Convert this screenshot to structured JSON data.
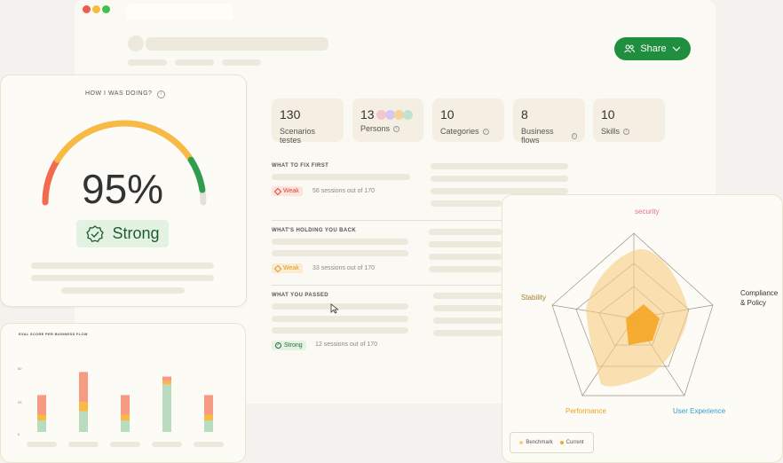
{
  "header": {
    "share_label": "Share",
    "share_color": "#1f8e3e"
  },
  "stats": [
    {
      "value": "130",
      "label": "Scenarios testes",
      "info": false
    },
    {
      "value": "13",
      "label": "Persons",
      "info": true
    },
    {
      "value": "10",
      "label": "Categories",
      "info": true
    },
    {
      "value": "8",
      "label": "Business flows",
      "info": true
    },
    {
      "value": "10",
      "label": "Skills",
      "info": true
    }
  ],
  "sections": {
    "fix": {
      "title": "WHAT TO FIX FIRST",
      "badge": "Weak",
      "sessions": "56 sessions out of 170"
    },
    "holding": {
      "title": "WHAT'S HOLDING YOU BACK",
      "badge": "Weak",
      "sessions": "33 sessions out of 170"
    },
    "passed": {
      "title": "WHAT YOU PASSED",
      "badge": "Strong",
      "sessions": "12 sessions out of 170"
    }
  },
  "score": {
    "title": "HOW I WAS DOING?",
    "value": "95%",
    "value_fraction": 0.95,
    "status": "Strong",
    "gauge_colors": [
      "#f36b4f",
      "#f9b945",
      "#2f9d4e",
      "#d6d3c7"
    ]
  },
  "eval_chart": {
    "title": "EVAL SCORE PER BUSINESS FLOW",
    "yticks": [
      "50",
      "25",
      "0"
    ]
  },
  "chart_data": {
    "type": "bar",
    "title": "EVAL SCORE PER BUSINESS FLOW",
    "categories": [
      "",
      "",
      "",
      "",
      ""
    ],
    "stacked": true,
    "ylim": [
      0,
      60
    ],
    "series": [
      {
        "color": "#b9dbbf",
        "values": [
          10,
          18,
          10,
          41,
          10
        ]
      },
      {
        "color": "#f9b945",
        "values": [
          5,
          8,
          5,
          3,
          5
        ]
      },
      {
        "color": "#f79a82",
        "values": [
          17,
          26,
          17,
          4,
          17
        ]
      }
    ]
  },
  "radar": {
    "axes": [
      "security",
      "Compliance & Policy",
      "User Experience",
      "Performance",
      "Stability"
    ],
    "axis_colors": [
      "#e96b9c",
      "#333333",
      "#2f9fd0",
      "#e8a41e",
      "#a37f33"
    ],
    "legend": [
      "Benchmark",
      "Current"
    ],
    "benchmark_color": "#f9cf82",
    "current_color": "#f5a623"
  }
}
